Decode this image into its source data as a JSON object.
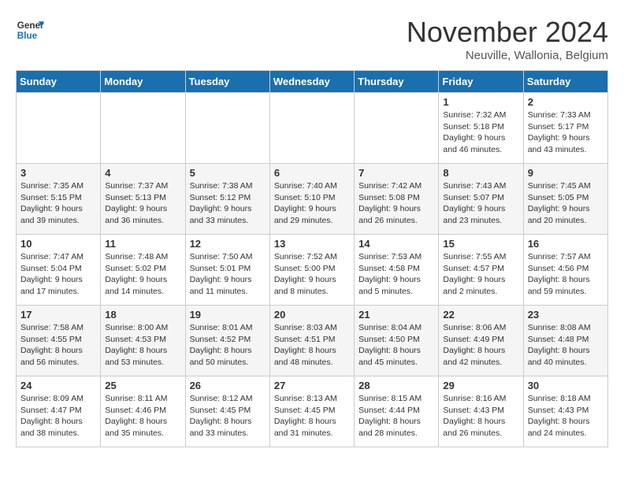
{
  "header": {
    "logo_line1": "General",
    "logo_line2": "Blue",
    "month_title": "November 2024",
    "subtitle": "Neuville, Wallonia, Belgium"
  },
  "columns": [
    "Sunday",
    "Monday",
    "Tuesday",
    "Wednesday",
    "Thursday",
    "Friday",
    "Saturday"
  ],
  "weeks": [
    [
      {
        "day": "",
        "info": ""
      },
      {
        "day": "",
        "info": ""
      },
      {
        "day": "",
        "info": ""
      },
      {
        "day": "",
        "info": ""
      },
      {
        "day": "",
        "info": ""
      },
      {
        "day": "1",
        "info": "Sunrise: 7:32 AM\nSunset: 5:18 PM\nDaylight: 9 hours and 46 minutes."
      },
      {
        "day": "2",
        "info": "Sunrise: 7:33 AM\nSunset: 5:17 PM\nDaylight: 9 hours and 43 minutes."
      }
    ],
    [
      {
        "day": "3",
        "info": "Sunrise: 7:35 AM\nSunset: 5:15 PM\nDaylight: 9 hours and 39 minutes."
      },
      {
        "day": "4",
        "info": "Sunrise: 7:37 AM\nSunset: 5:13 PM\nDaylight: 9 hours and 36 minutes."
      },
      {
        "day": "5",
        "info": "Sunrise: 7:38 AM\nSunset: 5:12 PM\nDaylight: 9 hours and 33 minutes."
      },
      {
        "day": "6",
        "info": "Sunrise: 7:40 AM\nSunset: 5:10 PM\nDaylight: 9 hours and 29 minutes."
      },
      {
        "day": "7",
        "info": "Sunrise: 7:42 AM\nSunset: 5:08 PM\nDaylight: 9 hours and 26 minutes."
      },
      {
        "day": "8",
        "info": "Sunrise: 7:43 AM\nSunset: 5:07 PM\nDaylight: 9 hours and 23 minutes."
      },
      {
        "day": "9",
        "info": "Sunrise: 7:45 AM\nSunset: 5:05 PM\nDaylight: 9 hours and 20 minutes."
      }
    ],
    [
      {
        "day": "10",
        "info": "Sunrise: 7:47 AM\nSunset: 5:04 PM\nDaylight: 9 hours and 17 minutes."
      },
      {
        "day": "11",
        "info": "Sunrise: 7:48 AM\nSunset: 5:02 PM\nDaylight: 9 hours and 14 minutes."
      },
      {
        "day": "12",
        "info": "Sunrise: 7:50 AM\nSunset: 5:01 PM\nDaylight: 9 hours and 11 minutes."
      },
      {
        "day": "13",
        "info": "Sunrise: 7:52 AM\nSunset: 5:00 PM\nDaylight: 9 hours and 8 minutes."
      },
      {
        "day": "14",
        "info": "Sunrise: 7:53 AM\nSunset: 4:58 PM\nDaylight: 9 hours and 5 minutes."
      },
      {
        "day": "15",
        "info": "Sunrise: 7:55 AM\nSunset: 4:57 PM\nDaylight: 9 hours and 2 minutes."
      },
      {
        "day": "16",
        "info": "Sunrise: 7:57 AM\nSunset: 4:56 PM\nDaylight: 8 hours and 59 minutes."
      }
    ],
    [
      {
        "day": "17",
        "info": "Sunrise: 7:58 AM\nSunset: 4:55 PM\nDaylight: 8 hours and 56 minutes."
      },
      {
        "day": "18",
        "info": "Sunrise: 8:00 AM\nSunset: 4:53 PM\nDaylight: 8 hours and 53 minutes."
      },
      {
        "day": "19",
        "info": "Sunrise: 8:01 AM\nSunset: 4:52 PM\nDaylight: 8 hours and 50 minutes."
      },
      {
        "day": "20",
        "info": "Sunrise: 8:03 AM\nSunset: 4:51 PM\nDaylight: 8 hours and 48 minutes."
      },
      {
        "day": "21",
        "info": "Sunrise: 8:04 AM\nSunset: 4:50 PM\nDaylight: 8 hours and 45 minutes."
      },
      {
        "day": "22",
        "info": "Sunrise: 8:06 AM\nSunset: 4:49 PM\nDaylight: 8 hours and 42 minutes."
      },
      {
        "day": "23",
        "info": "Sunrise: 8:08 AM\nSunset: 4:48 PM\nDaylight: 8 hours and 40 minutes."
      }
    ],
    [
      {
        "day": "24",
        "info": "Sunrise: 8:09 AM\nSunset: 4:47 PM\nDaylight: 8 hours and 38 minutes."
      },
      {
        "day": "25",
        "info": "Sunrise: 8:11 AM\nSunset: 4:46 PM\nDaylight: 8 hours and 35 minutes."
      },
      {
        "day": "26",
        "info": "Sunrise: 8:12 AM\nSunset: 4:45 PM\nDaylight: 8 hours and 33 minutes."
      },
      {
        "day": "27",
        "info": "Sunrise: 8:13 AM\nSunset: 4:45 PM\nDaylight: 8 hours and 31 minutes."
      },
      {
        "day": "28",
        "info": "Sunrise: 8:15 AM\nSunset: 4:44 PM\nDaylight: 8 hours and 28 minutes."
      },
      {
        "day": "29",
        "info": "Sunrise: 8:16 AM\nSunset: 4:43 PM\nDaylight: 8 hours and 26 minutes."
      },
      {
        "day": "30",
        "info": "Sunrise: 8:18 AM\nSunset: 4:43 PM\nDaylight: 8 hours and 24 minutes."
      }
    ]
  ]
}
